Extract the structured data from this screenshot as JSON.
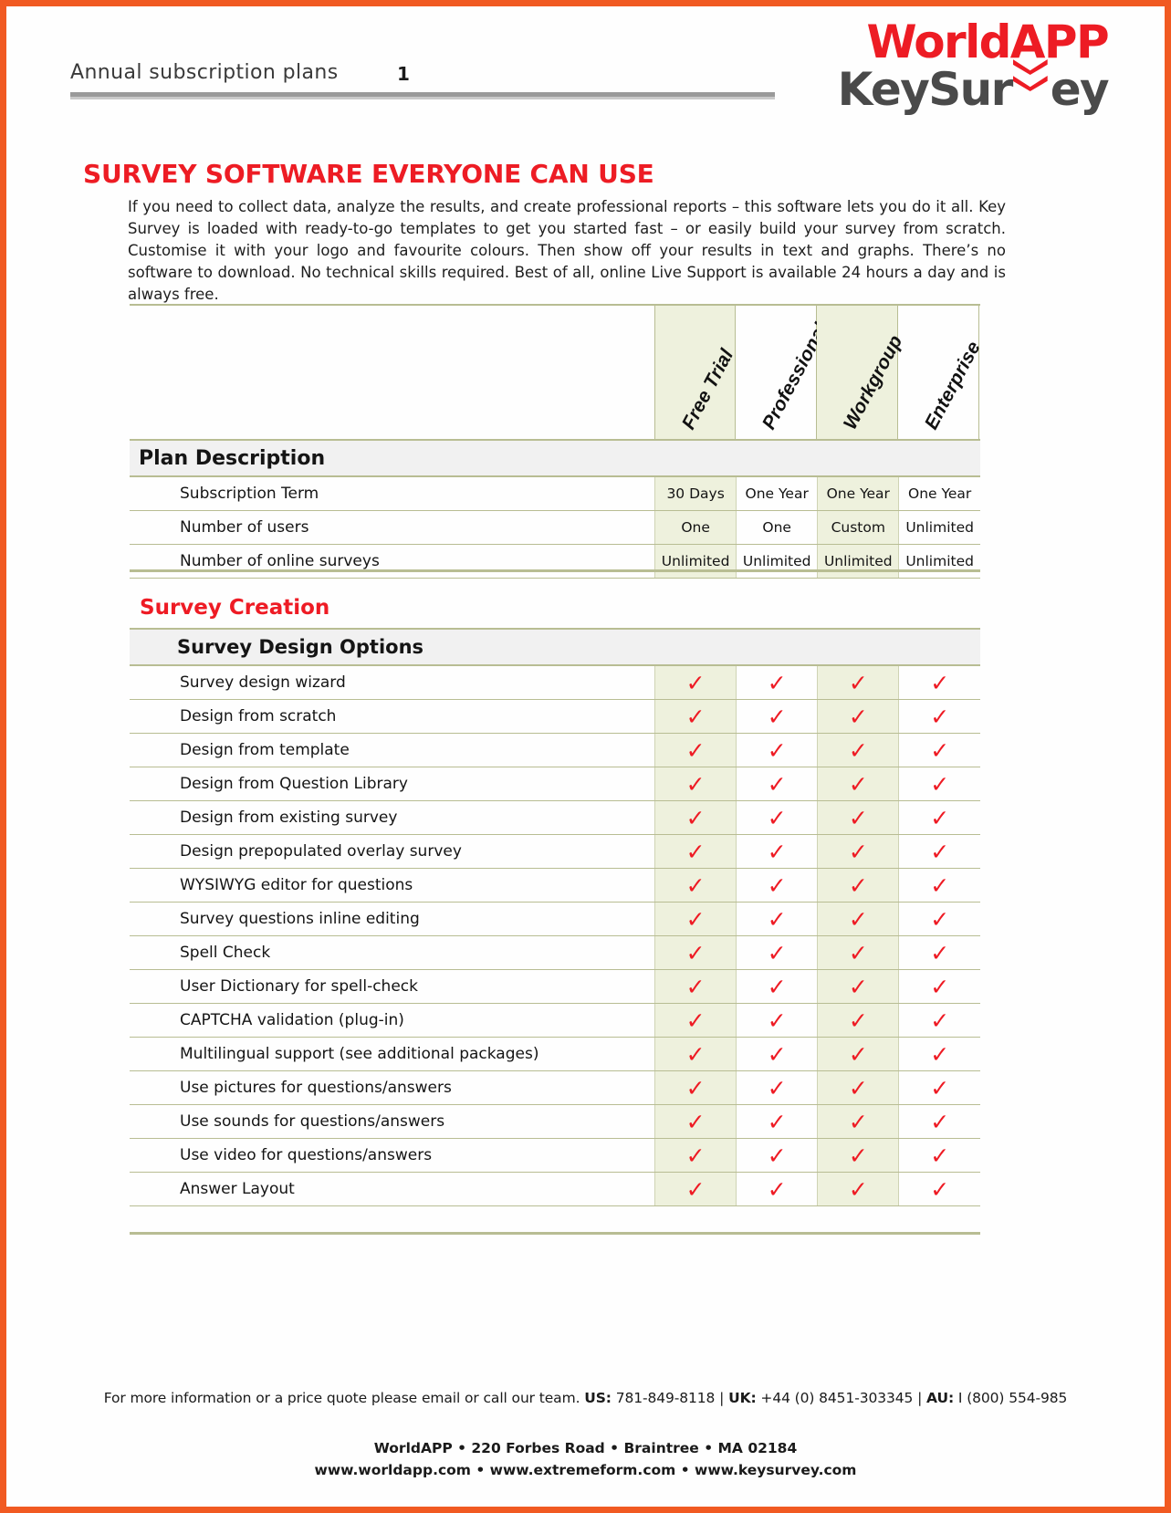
{
  "header": {
    "title": "Annual subscription plans",
    "page_number": "1",
    "logo": {
      "brand_top": "WorldAPP",
      "brand_bottom_pre": "KeySur",
      "brand_bottom_post": "ey",
      "chevron_icon": "double-chevron-down-red",
      "brand_red": "#ed1c24",
      "brand_gray": "#4a4a4a"
    }
  },
  "headline": "SURVEY SOFTWARE EVERYONE CAN USE",
  "intro": "If you need to collect data, analyze the results, and create professional reports – this software lets you do it all. Key Survey is loaded with ready-to-go templates to get you started fast – or easily build your survey from scratch. Customise it with your logo and favourite colours. Then show off your results in text and graphs. There’s no software to download. No technical skills required. Best of all, online Live Support is available 24 hours a day and is always free.",
  "table": {
    "plans": [
      "Free Trial",
      "Professional",
      "Workgroup",
      "Enterprise"
    ],
    "plan_description": {
      "section_title": "Plan Description",
      "rows": [
        {
          "label": "Subscription Term",
          "values": [
            "30 Days",
            "One Year",
            "One Year",
            "One Year"
          ]
        },
        {
          "label": "Number of users",
          "values": [
            "One",
            "One",
            "Custom",
            "Unlimited"
          ]
        },
        {
          "label": "Number of online surveys",
          "values": [
            "Unlimited",
            "Unlimited",
            "Unlimited",
            "Unlimited"
          ]
        }
      ]
    },
    "survey_creation": {
      "section_title": "Survey Creation",
      "subsection_title": "Survey Design Options",
      "check_glyph": "✓",
      "rows": [
        {
          "label": "Survey design wizard",
          "values": [
            "✓",
            "✓",
            "✓",
            "✓"
          ]
        },
        {
          "label": "Design from scratch",
          "values": [
            "✓",
            "✓",
            "✓",
            "✓"
          ]
        },
        {
          "label": "Design from template",
          "values": [
            "✓",
            "✓",
            "✓",
            "✓"
          ]
        },
        {
          "label": "Design from Question Library",
          "values": [
            "✓",
            "✓",
            "✓",
            "✓"
          ]
        },
        {
          "label": "Design from existing survey",
          "values": [
            "✓",
            "✓",
            "✓",
            "✓"
          ]
        },
        {
          "label": "Design prepopulated overlay survey",
          "values": [
            "✓",
            "✓",
            "✓",
            "✓"
          ]
        },
        {
          "label": "WYSIWYG editor for questions",
          "values": [
            "✓",
            "✓",
            "✓",
            "✓"
          ]
        },
        {
          "label": "Survey questions inline editing",
          "values": [
            "✓",
            "✓",
            "✓",
            "✓"
          ]
        },
        {
          "label": "Spell Check",
          "values": [
            "✓",
            "✓",
            "✓",
            "✓"
          ]
        },
        {
          "label": "User Dictionary for spell-check",
          "values": [
            "✓",
            "✓",
            "✓",
            "✓"
          ]
        },
        {
          "label": "CAPTCHA validation (plug-in)",
          "values": [
            "✓",
            "✓",
            "✓",
            "✓"
          ]
        },
        {
          "label": "Multilingual support (see additional packages)",
          "values": [
            "✓",
            "✓",
            "✓",
            "✓"
          ]
        },
        {
          "label": "Use pictures for questions/answers",
          "values": [
            "✓",
            "✓",
            "✓",
            "✓"
          ]
        },
        {
          "label": "Use sounds for questions/answers",
          "values": [
            "✓",
            "✓",
            "✓",
            "✓"
          ]
        },
        {
          "label": "Use video for questions/answers",
          "values": [
            "✓",
            "✓",
            "✓",
            "✓"
          ]
        },
        {
          "label": "Answer Layout",
          "values": [
            "✓",
            "✓",
            "✓",
            "✓"
          ]
        }
      ]
    }
  },
  "footer": {
    "contact_lead": "For more information or a price quote please email or call our team. ",
    "us_label": "US:",
    "us_phone": " 781-849-8118 | ",
    "uk_label": "UK:",
    "uk_phone": " +44 (0) 8451-303345 | ",
    "au_label": "AU:",
    "au_phone": " I (800) 554-985",
    "address": "WorldAPP • 220 Forbes Road • Braintree • MA 02184",
    "links": "www.worldapp.com • www.extremeform.com • www.keysurvey.com"
  },
  "colors": {
    "border": "#f15a22",
    "brand_red": "#ee1b24",
    "tint": "#eef1dd",
    "rule": "#b8bd93"
  }
}
